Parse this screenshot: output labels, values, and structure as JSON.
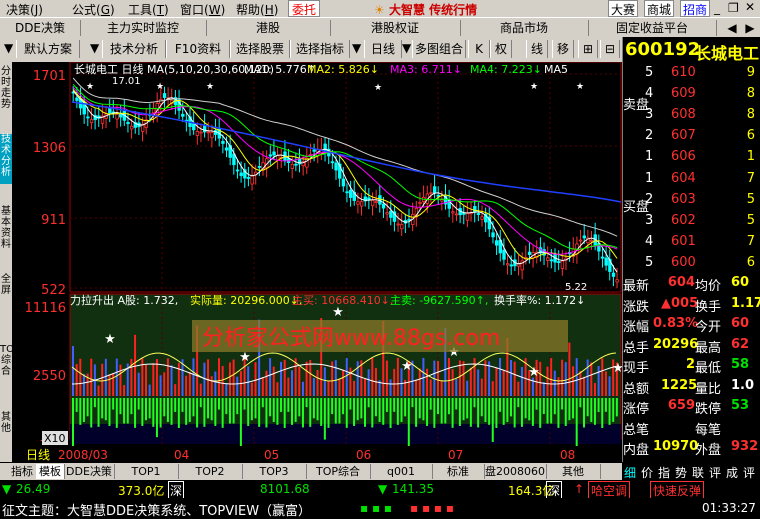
{
  "menu": {
    "items": [
      "决策",
      "公式",
      "工具",
      "窗口",
      "帮助"
    ],
    "mnemonics": [
      "J",
      "G",
      "T",
      "W",
      "H"
    ],
    "delegate_label": "委托",
    "brand": "大智慧",
    "brand_tag": "传统行情",
    "right_links": [
      "大赛",
      "商城",
      "招商"
    ]
  },
  "tabs": [
    "DDE决策",
    "主力实时监控",
    "港股",
    "港股权证",
    "商品市场",
    "固定收益平台"
  ],
  "toolbar": {
    "items": [
      "默认方案",
      "技术分析",
      "F10资料",
      "选择股票",
      "选择指标",
      "日线",
      "多图组合",
      "K",
      "权",
      "线",
      "移"
    ]
  },
  "stock": {
    "code": "600192",
    "name": "长城电工"
  },
  "left_tabs": [
    "分时走势",
    "技术分析",
    "基本资料",
    "全屏",
    "TOP综合",
    "其他"
  ],
  "chart": {
    "title_left": "长城电工 日线 MA(5,10,20,30,60,120)",
    "ma_legend": [
      {
        "label": "MA1: 5.776↑",
        "color": "#ffffff"
      },
      {
        "label": "MA2: 5.826↓",
        "color": "#ffff00"
      },
      {
        "label": "MA3: 6.711↓",
        "color": "#ff00ff"
      },
      {
        "label": "MA4: 7.223↓",
        "color": "#00ff00"
      },
      {
        "label": "MA5",
        "color": "#ffffff"
      }
    ],
    "price_ticks": [
      "1701",
      "1306",
      "911",
      "522"
    ],
    "high_label": "17.01",
    "low_label": "5.22",
    "sub_header": [
      {
        "label": "力拉升出 A股: 1.732,",
        "color": "#ffffff"
      },
      {
        "label": "实际量: 20296.000↓,",
        "color": "#ffff00"
      },
      {
        "label": "主买: 10668.410↓,",
        "color": "#ff3030"
      },
      {
        "label": "主卖: -9627.590↑,",
        "color": "#00ff00"
      },
      {
        "label": "换手率%: 1.172↓",
        "color": "#ffffff"
      }
    ],
    "sub_ticks": [
      "11116",
      "2550",
      "-6"
    ],
    "x_unit_label": "X10",
    "watermark": "分析家公式网www.88gs.com",
    "period_label": "日线",
    "dates": [
      "2008/03",
      "04",
      "05",
      "06",
      "07",
      "08"
    ]
  },
  "orderbook": {
    "sell_label": "卖盘",
    "buy_label": "买盘",
    "sell": [
      {
        "level": "5",
        "price": "610",
        "vol": "9"
      },
      {
        "level": "4",
        "price": "609",
        "vol": "8"
      },
      {
        "level": "3",
        "price": "608",
        "vol": "8"
      },
      {
        "level": "2",
        "price": "607",
        "vol": "6"
      },
      {
        "level": "1",
        "price": "606",
        "vol": "1"
      }
    ],
    "buy": [
      {
        "level": "1",
        "price": "604",
        "vol": "7"
      },
      {
        "level": "2",
        "price": "603",
        "vol": "5"
      },
      {
        "level": "3",
        "price": "602",
        "vol": "5"
      },
      {
        "level": "4",
        "price": "601",
        "vol": "7"
      },
      {
        "level": "5",
        "price": "600",
        "vol": "6"
      }
    ]
  },
  "stats": [
    {
      "l1": "最新",
      "v1": "604",
      "l2": "均价",
      "v2": "60"
    },
    {
      "l1": "涨跌",
      "v1": "▲005",
      "l2": "换手",
      "v2": "1.17"
    },
    {
      "l1": "涨幅",
      "v1": "0.83%",
      "l2": "今开",
      "v2": "60"
    },
    {
      "l1": "总手",
      "v1": "20296",
      "l2": "最高",
      "v2": "62"
    },
    {
      "l1": "现手",
      "v1": "2",
      "l2": "最低",
      "v2": "58"
    },
    {
      "l1": "总额",
      "v1": "1225",
      "l2": "量比",
      "v2": "1.0"
    },
    {
      "l1": "涨停",
      "v1": "659",
      "l2": "跌停",
      "v2": "53"
    },
    {
      "l1": "总笔",
      "v1": "",
      "l2": "每笔",
      "v2": ""
    },
    {
      "l1": "内盘",
      "v1": "10970",
      "l2": "外盘",
      "v2": "932"
    }
  ],
  "right_bottom_tabs": [
    "细",
    "价",
    "指",
    "势",
    "联",
    "评",
    "成",
    "评"
  ],
  "bottom_tabs": [
    "指标",
    "模板",
    "DDE决策",
    "TOP1",
    "TOP2",
    "TOP3",
    "TOP综合",
    "q001",
    "标准",
    "盘2008060",
    "其他"
  ],
  "status1": {
    "v1": "26.49",
    "v2": "373.0亿",
    "v2_suffix": "深",
    "v3": "8101.68",
    "v4": "141.35",
    "v5": "164.3亿",
    "v5_suffix": "深",
    "alert1": "哈空调",
    "alert2": "快速反弹"
  },
  "status2": {
    "news": "征文主题：大智慧DDE决策系统、TOPVIEW（赢富）",
    "clock": "01:33:27"
  }
}
